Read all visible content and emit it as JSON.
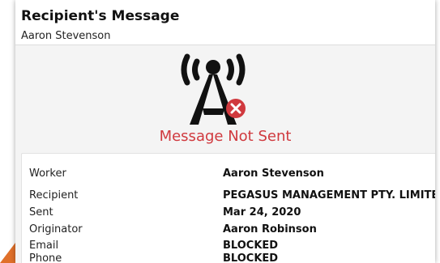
{
  "header": {
    "title": "Recipient's Message",
    "subtitle": "Aaron Stevenson"
  },
  "status": {
    "icon": "antenna-signal-error-icon",
    "text": "Message Not Sent",
    "color": "#d0393e"
  },
  "details": [
    {
      "label": "Worker",
      "value": "Aaron Stevenson"
    },
    {
      "label": "Recipient",
      "value": "PEGASUS MANAGEMENT PTY. LIMITED"
    },
    {
      "label": "Sent",
      "value": "Mar 24, 2020"
    },
    {
      "label": "Originator",
      "value": "Aaron Robinson"
    },
    {
      "label": "Email",
      "value": "BLOCKED"
    },
    {
      "label": "Phone",
      "value": "BLOCKED"
    }
  ],
  "accent_color": "#e0702a"
}
